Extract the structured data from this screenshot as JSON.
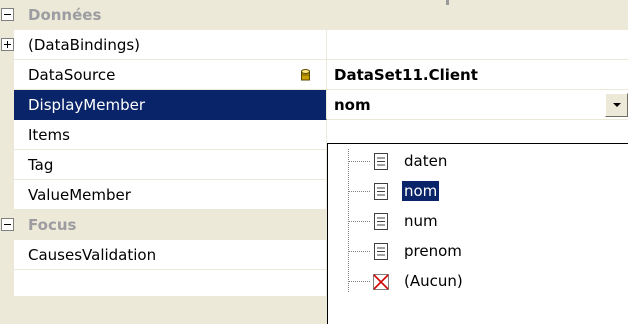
{
  "categories": {
    "donnees": {
      "label": "Données",
      "toggle": "collapse"
    },
    "focus": {
      "label": "Focus",
      "toggle": "collapse"
    }
  },
  "properties": {
    "databindings": {
      "name": "(DataBindings)",
      "toggle": "expand",
      "value": ""
    },
    "datasource": {
      "name": "DataSource",
      "value": "DataSet11.Client",
      "icon": "database-icon"
    },
    "displaymember": {
      "name": "DisplayMember",
      "value": "nom",
      "selected": true
    },
    "items": {
      "name": "Items",
      "value": ""
    },
    "tag": {
      "name": "Tag",
      "value": ""
    },
    "valuemember": {
      "name": "ValueMember",
      "value": ""
    },
    "causesvalidation": {
      "name": "CausesValidation",
      "value": ""
    }
  },
  "dropdown": {
    "items": [
      {
        "label": "daten",
        "icon": "field-icon",
        "selected": false
      },
      {
        "label": "nom",
        "icon": "field-icon",
        "selected": true
      },
      {
        "label": "num",
        "icon": "field-icon",
        "selected": false
      },
      {
        "label": "prenom",
        "icon": "field-icon",
        "selected": false
      },
      {
        "label": "(Aucun)",
        "icon": "none-x-icon",
        "selected": false
      }
    ]
  },
  "colors": {
    "selection": "#0a246a",
    "category_background": "#ece9d8",
    "category_text": "#9d9da1",
    "grid_line": "#ece9d8",
    "database_icon": "#c8a000"
  }
}
